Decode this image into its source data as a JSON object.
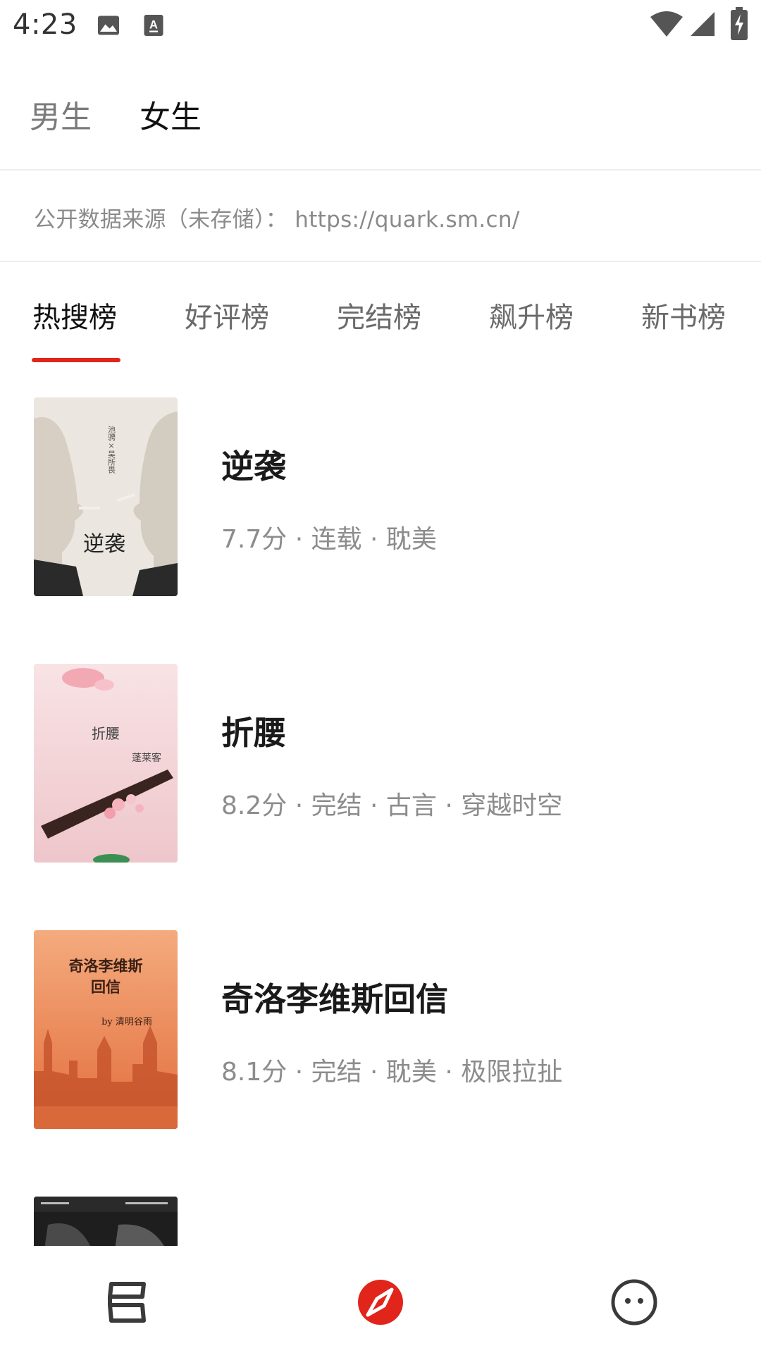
{
  "status_bar": {
    "time": "4:23",
    "icons": [
      "image-icon",
      "font-download-icon",
      "wifi-icon",
      "signal-icon",
      "battery-charging-icon"
    ]
  },
  "gender_tabs": [
    {
      "label": "男生",
      "active": false
    },
    {
      "label": "女生",
      "active": true
    }
  ],
  "source_note": "公开数据来源（未存储）： https://quark.sm.cn/",
  "rank_tabs": [
    {
      "label": "热搜榜",
      "active": true
    },
    {
      "label": "好评榜",
      "active": false
    },
    {
      "label": "完结榜",
      "active": false
    },
    {
      "label": "飙升榜",
      "active": false
    },
    {
      "label": "新书榜",
      "active": false
    }
  ],
  "books": [
    {
      "title": "逆袭",
      "meta": "7.7分 · 连载 · 耽美",
      "cover_text": [
        "逆袭",
        "池骋×吴所畏"
      ],
      "cover_colors": [
        "#e9e4dc",
        "#cfc7bb"
      ]
    },
    {
      "title": "折腰",
      "meta": "8.2分 · 完结 · 古言 · 穿越时空",
      "cover_text": [
        "折腰",
        "蓬莱客"
      ],
      "cover_colors": [
        "#f6dde0",
        "#e8b8bf"
      ]
    },
    {
      "title": "奇洛李维斯回信",
      "meta": "8.1分 · 完结 · 耽美 · 极限拉扯",
      "cover_text": [
        "奇洛李维斯",
        "回信",
        "by 清明谷雨"
      ],
      "cover_colors": [
        "#f1a274",
        "#e06c3c"
      ]
    },
    {
      "title": "",
      "meta": "",
      "cover_text": [],
      "cover_colors": [
        "#222222",
        "#555555"
      ]
    }
  ],
  "bottom_nav": [
    {
      "name": "bookshelf-icon",
      "active": false
    },
    {
      "name": "discover-compass-icon",
      "active": true
    },
    {
      "name": "profile-face-icon",
      "active": false
    }
  ],
  "colors": {
    "accent": "#e1251b",
    "text_primary": "#1a1a1a",
    "text_secondary": "#8c8c8c"
  }
}
